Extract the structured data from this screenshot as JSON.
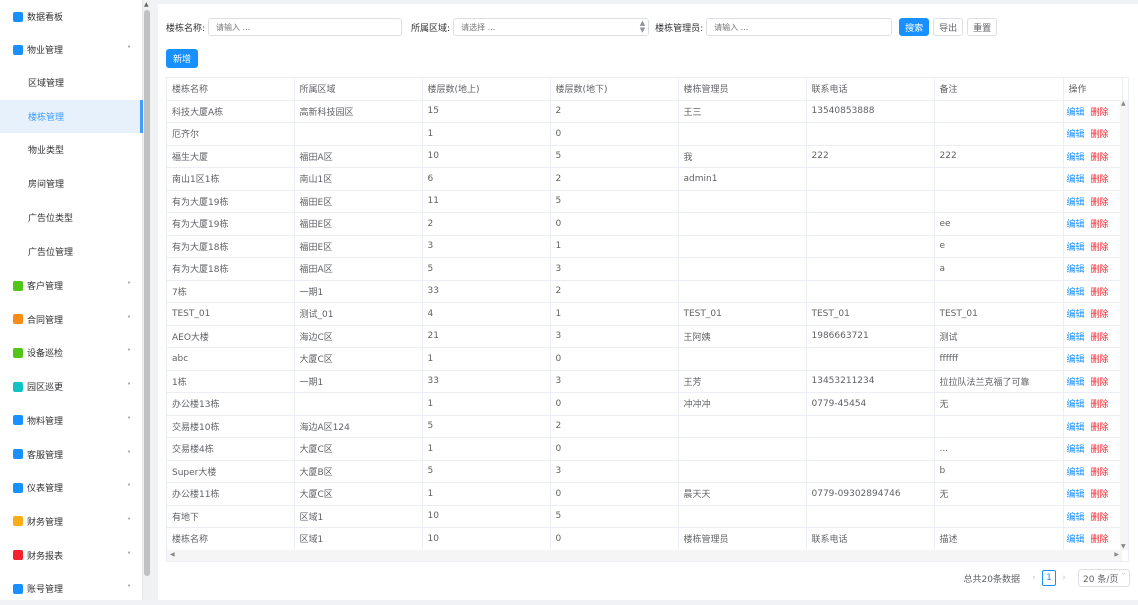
{
  "sidebar": {
    "items": [
      {
        "label": "数据看板",
        "icon": "dashboard-icon",
        "color": "#1890ff"
      },
      {
        "label": "物业管理",
        "icon": "property-icon",
        "color": "#1890ff",
        "arrow": "˄"
      },
      {
        "label": "客户管理",
        "icon": "customer-icon",
        "color": "#52c41a",
        "arrow": "˅"
      },
      {
        "label": "合同管理",
        "icon": "contract-icon",
        "color": "#fa8c16",
        "arrow": "˅"
      },
      {
        "label": "设备巡检",
        "icon": "device-icon",
        "color": "#52c41a",
        "arrow": "˅"
      },
      {
        "label": "园区巡更",
        "icon": "patrol-icon",
        "color": "#13c2c2",
        "arrow": "˅"
      },
      {
        "label": "物料管理",
        "icon": "material-icon",
        "color": "#1890ff",
        "arrow": "˅"
      },
      {
        "label": "客服管理",
        "icon": "service-icon",
        "color": "#1890ff",
        "arrow": "˅"
      },
      {
        "label": "仪表管理",
        "icon": "meter-icon",
        "color": "#1890ff",
        "arrow": "˅"
      },
      {
        "label": "财务管理",
        "icon": "finance-icon",
        "color": "#faad14",
        "arrow": "˅"
      },
      {
        "label": "财务报表",
        "icon": "report-icon",
        "color": "#f5222d",
        "arrow": "˅"
      },
      {
        "label": "账号管理",
        "icon": "account-icon",
        "color": "#1890ff",
        "arrow": "˅"
      }
    ],
    "sub_items": [
      "区域管理",
      "楼栋管理",
      "物业类型",
      "房间管理",
      "广告位类型",
      "广告位管理"
    ]
  },
  "search": {
    "name_label": "楼栋名称:",
    "name_placeholder": "请输入 ...",
    "area_label": "所属区域:",
    "area_placeholder": "请选择 ...",
    "manager_label": "楼栋管理员:",
    "manager_placeholder": "请输入 ...",
    "search_btn": "搜索",
    "export_btn": "导出",
    "reset_btn": "重置"
  },
  "add_btn": "新增",
  "table": {
    "headers": [
      "楼栋名称",
      "所属区域",
      "楼层数(地上)",
      "楼层数(地下)",
      "楼栋管理员",
      "联系电话",
      "备注",
      "操作"
    ],
    "edit_label": "编辑",
    "delete_label": "删除",
    "rows": [
      [
        "科技大厦A栋",
        "高新科技园区",
        "15",
        "2",
        "王三",
        "13540853888",
        ""
      ],
      [
        "厄齐尔",
        "",
        "1",
        "0",
        "",
        "",
        ""
      ],
      [
        "福生大厦",
        "福田A区",
        "10",
        "5",
        "我",
        "222",
        "222"
      ],
      [
        "南山1区1栋",
        "南山1区",
        "6",
        "2",
        "admin1",
        "",
        ""
      ],
      [
        "有为大厦19栋",
        "福田E区",
        "11",
        "5",
        "",
        "",
        ""
      ],
      [
        "有为大厦19栋",
        "福田E区",
        "2",
        "0",
        "",
        "",
        "ee"
      ],
      [
        "有为大厦18栋",
        "福田E区",
        "3",
        "1",
        "",
        "",
        "e"
      ],
      [
        "有为大厦18栋",
        "福田A区",
        "5",
        "3",
        "",
        "",
        "a"
      ],
      [
        "7栋",
        "一期1",
        "33",
        "2",
        "",
        "",
        ""
      ],
      [
        "TEST_01",
        "测试_01",
        "4",
        "1",
        "TEST_01",
        "TEST_01",
        "TEST_01"
      ],
      [
        "AEO大楼",
        "海边C区",
        "21",
        "3",
        "王阿姨",
        "1986663721",
        "测试"
      ],
      [
        "abc",
        "大厦C区",
        "1",
        "0",
        "",
        "",
        "ffffff"
      ],
      [
        "1栋",
        "一期1",
        "33",
        "3",
        "王芳",
        "13453211234",
        "拉拉队法兰克福了可靠"
      ],
      [
        "办公楼13栋",
        "",
        "1",
        "0",
        "冲冲冲",
        "0779-45454",
        "无"
      ],
      [
        "交易楼10栋",
        "海边A区124",
        "5",
        "2",
        "",
        "",
        ""
      ],
      [
        "交易楼4栋",
        "大厦C区",
        "1",
        "0",
        "",
        "",
        "..."
      ],
      [
        "Super大楼",
        "大厦B区",
        "5",
        "3",
        "",
        "",
        "b"
      ],
      [
        "办公楼11栋",
        "大厦C区",
        "1",
        "0",
        "晨天天",
        "0779-09302894746",
        "无"
      ],
      [
        "有地下",
        "区域1",
        "10",
        "5",
        "",
        "",
        ""
      ],
      [
        "楼栋名称",
        "区域1",
        "10",
        "0",
        "楼栋管理员",
        "联系电话",
        "描述"
      ]
    ]
  },
  "pager": {
    "total": "总共20条数据",
    "current": "1",
    "size": "20 条/页"
  }
}
